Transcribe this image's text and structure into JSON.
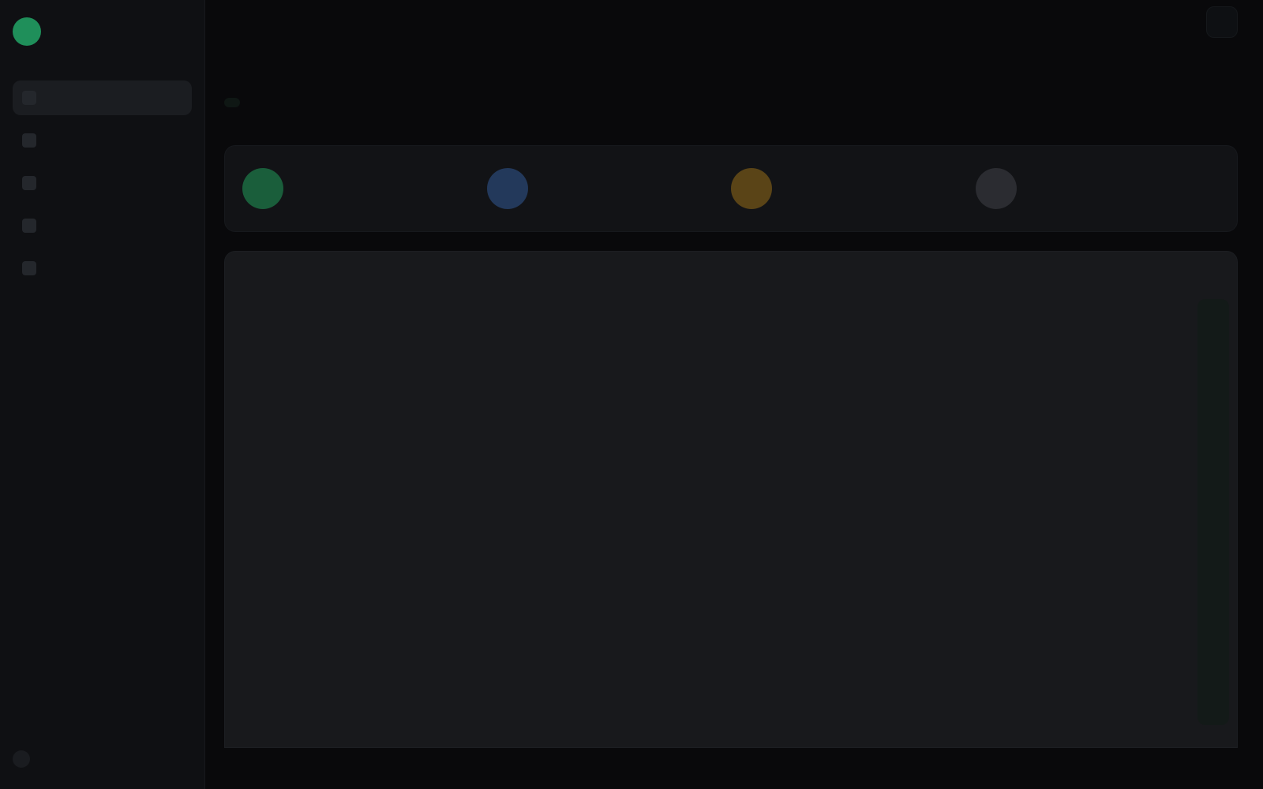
{
  "app": {
    "brand_name": "",
    "topbar_title": ""
  },
  "sidebar": {
    "items": [
      {
        "label": ""
      },
      {
        "label": ""
      },
      {
        "label": ""
      },
      {
        "label": ""
      },
      {
        "label": ""
      }
    ],
    "footer_label": ""
  },
  "page": {
    "title": "",
    "subtitle": ""
  },
  "tabs": [
    {
      "label": ""
    },
    {
      "label": ""
    },
    {
      "label": ""
    }
  ],
  "stats": [
    {
      "label": "",
      "value": "",
      "color": "#1a5e3b"
    },
    {
      "label": "",
      "value": "",
      "color": "#23395b"
    },
    {
      "label": "",
      "value": "",
      "color": "#5a4417"
    },
    {
      "label": "",
      "value": "",
      "color": "#2b2c31"
    }
  ],
  "panel": {
    "title": "",
    "subtitle": "",
    "rows": [
      {
        "label": ""
      },
      {
        "label": ""
      },
      {
        "label": ""
      },
      {
        "label": ""
      },
      {
        "label": ""
      },
      {
        "label": ""
      },
      {
        "label": ""
      },
      {
        "label": ""
      }
    ]
  },
  "colors": {
    "accent": "#1f8f5a",
    "background": "#09090b",
    "sidebar": "#0f1013",
    "panel": "#18191c"
  }
}
